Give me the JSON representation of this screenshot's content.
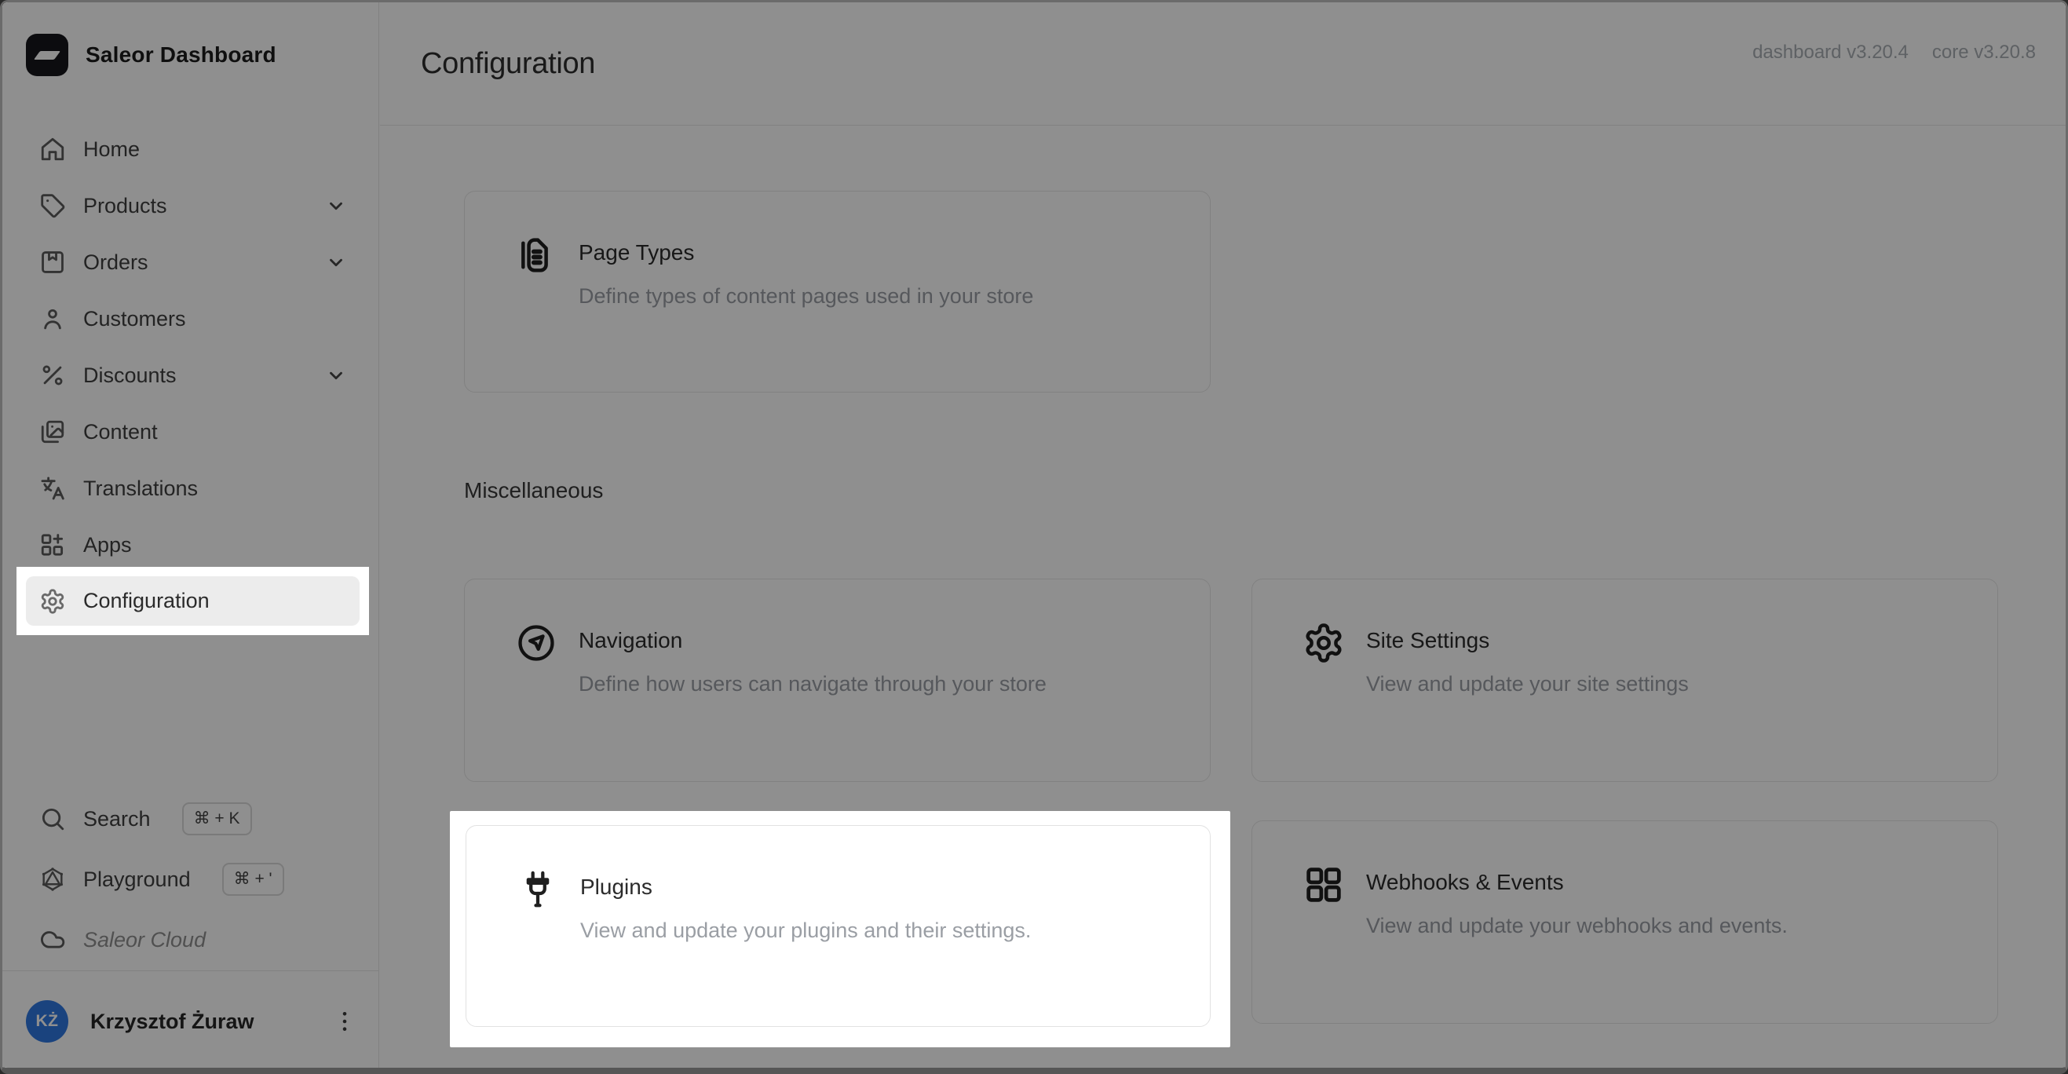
{
  "sidebar": {
    "brand": "Saleor Dashboard",
    "items": [
      {
        "label": "Home",
        "icon": "home-icon",
        "expandable": false
      },
      {
        "label": "Products",
        "icon": "tag-icon",
        "expandable": true
      },
      {
        "label": "Orders",
        "icon": "package-icon",
        "expandable": true
      },
      {
        "label": "Customers",
        "icon": "user-icon",
        "expandable": false
      },
      {
        "label": "Discounts",
        "icon": "percent-icon",
        "expandable": true
      },
      {
        "label": "Content",
        "icon": "pages-icon",
        "expandable": false
      },
      {
        "label": "Translations",
        "icon": "translate-icon",
        "expandable": false
      },
      {
        "label": "Apps",
        "icon": "apps-grid-icon",
        "expandable": false
      },
      {
        "label": "Configuration",
        "icon": "gear-icon",
        "expandable": false,
        "selected": true,
        "spotlighted": true
      }
    ],
    "footer": [
      {
        "label": "Search",
        "icon": "search-icon",
        "shortcut": "⌘ + K"
      },
      {
        "label": "Playground",
        "icon": "graphql-icon",
        "shortcut": "⌘ + '"
      },
      {
        "label": "Saleor Cloud",
        "icon": "cloud-icon",
        "shortcut": ""
      }
    ],
    "user": {
      "initials": "KŻ",
      "name": "Krzysztof Żuraw"
    }
  },
  "header": {
    "title": "Configuration",
    "dashboard_version": "dashboard v3.20.4",
    "core_version": "core v3.20.8"
  },
  "content": {
    "section_label": "Miscellaneous",
    "cards": [
      {
        "title": "Page Types",
        "description": "Define types of content pages used in your store",
        "icon": "page-types-icon",
        "spotlighted": false
      },
      {
        "title": "Navigation",
        "description": "Define how users can navigate through your store",
        "icon": "navigation-icon",
        "spotlighted": false
      },
      {
        "title": "Site Settings",
        "description": "View and update your site settings",
        "icon": "gear-icon",
        "spotlighted": false
      },
      {
        "title": "Plugins",
        "description": "View and update your plugins and their settings.",
        "icon": "plug-icon",
        "spotlighted": true
      },
      {
        "title": "Webhooks & Events",
        "description": "View and update your webhooks and events.",
        "icon": "webhooks-icon",
        "spotlighted": false
      }
    ]
  },
  "colors": {
    "avatar_blue": "#2f78e0",
    "selected_item_bg": "#ececec",
    "dim_overlay": "rgba(0,0,0,0.44)",
    "border": "#e6e6e6",
    "description_text": "#9a9ea4",
    "logo_bg": "#17171b"
  }
}
